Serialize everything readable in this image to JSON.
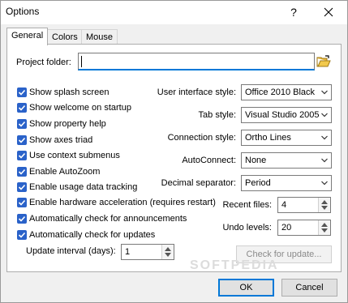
{
  "window": {
    "title": "Options"
  },
  "tabs": [
    {
      "label": "General",
      "active": true
    },
    {
      "label": "Colors",
      "active": false
    },
    {
      "label": "Mouse",
      "active": false
    }
  ],
  "project_folder": {
    "label": "Project folder:",
    "value": ""
  },
  "checkboxes": [
    {
      "label": "Show splash screen",
      "checked": true
    },
    {
      "label": "Show welcome on startup",
      "checked": true
    },
    {
      "label": "Show property help",
      "checked": true
    },
    {
      "label": "Show axes triad",
      "checked": true
    },
    {
      "label": "Use context submenus",
      "checked": true
    },
    {
      "label": "Enable AutoZoom",
      "checked": true
    },
    {
      "label": "Enable usage data tracking",
      "checked": true
    },
    {
      "label": "Enable hardware acceleration (requires restart)",
      "checked": true
    },
    {
      "label": "Automatically check for announcements",
      "checked": true
    },
    {
      "label": "Automatically check for updates",
      "checked": true
    }
  ],
  "update_interval": {
    "label": "Update interval (days):",
    "value": "1"
  },
  "combos": [
    {
      "label": "User interface style:",
      "value": "Office 2010 Black"
    },
    {
      "label": "Tab style:",
      "value": "Visual Studio 2005"
    },
    {
      "label": "Connection style:",
      "value": "Ortho Lines"
    },
    {
      "label": "AutoConnect:",
      "value": "None"
    },
    {
      "label": "Decimal separator:",
      "value": "Period"
    }
  ],
  "recent_files": {
    "label": "Recent files:",
    "value": "4"
  },
  "undo_levels": {
    "label": "Undo levels:",
    "value": "20"
  },
  "buttons": {
    "check_update": "Check for update...",
    "ok": "OK",
    "cancel": "Cancel"
  },
  "watermark": "SOFTPEDIA",
  "colors": {
    "accent": "#0078d7",
    "checkbox": "#2a62c9"
  },
  "icons": {
    "help": "question-mark",
    "close": "x",
    "folder": "open-folder"
  }
}
